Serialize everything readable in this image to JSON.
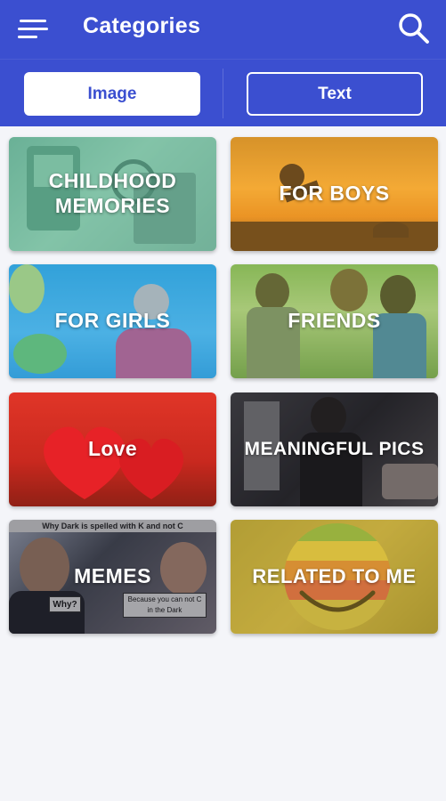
{
  "header": {
    "title": "Categories",
    "menu_icon": "hamburger-menu-icon",
    "search_icon": "search-icon"
  },
  "tabs": [
    {
      "label": "Image",
      "selected": true
    },
    {
      "label": "Text",
      "selected": false
    }
  ],
  "categories": [
    {
      "label": "CHILDHOOD\nMEMORIES"
    },
    {
      "label": "FOR BOYS"
    },
    {
      "label": "FOR GIRLS"
    },
    {
      "label": "FRIENDS"
    },
    {
      "label": "Love"
    },
    {
      "label": "MEANINGFUL PICS"
    },
    {
      "label": "MEMES",
      "meme_texts": [
        "Why Dark is spelled with K and not C",
        "Why?",
        "Because you can not C in the Dark"
      ]
    },
    {
      "label": "RELATED TO ME"
    }
  ],
  "colors": {
    "primary": "#3b4fd0",
    "background": "#f4f5f9"
  }
}
